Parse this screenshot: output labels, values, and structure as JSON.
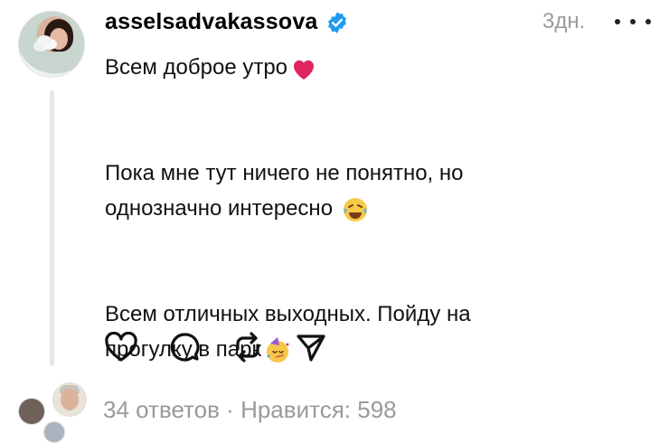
{
  "post": {
    "username": "asselsadvakassova",
    "time": "3дн.",
    "lines": [
      "Всем доброе утро",
      "",
      "Пока мне тут ничего не понятно, но",
      "однозначно интересно",
      "",
      "Всем отличных выходных. Пойду на",
      "прогулку в парк"
    ],
    "emojis": {
      "line1": "heart",
      "line4": "laughing-tears",
      "line7": "party-face"
    }
  },
  "actions": [
    "like-icon",
    "comment-icon",
    "repost-icon",
    "share-icon"
  ],
  "footer": {
    "replies": "34 ответов",
    "separator": " · ",
    "likes": "Нравится: 598"
  },
  "colors": {
    "muted": "#9a9a9a",
    "verified": "#1d9bf0",
    "heart": "#e0245e"
  }
}
